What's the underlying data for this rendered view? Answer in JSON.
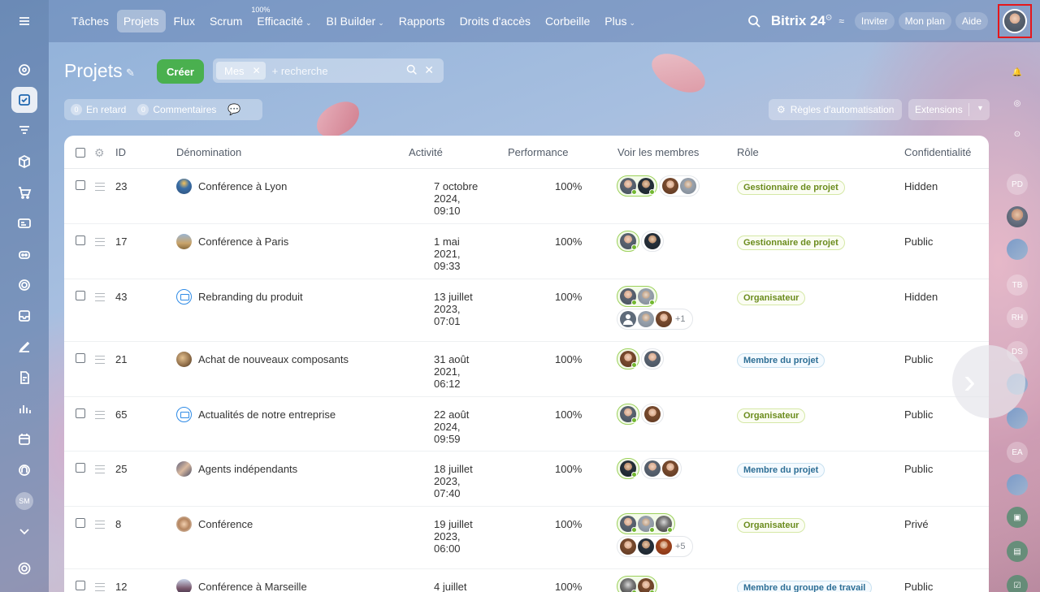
{
  "topbar": {
    "nav": [
      {
        "label": "Tâches",
        "active": false,
        "dropdown": false,
        "sup": ""
      },
      {
        "label": "Projets",
        "active": true,
        "dropdown": false,
        "sup": ""
      },
      {
        "label": "Flux",
        "active": false,
        "dropdown": false,
        "sup": ""
      },
      {
        "label": "Scrum",
        "active": false,
        "dropdown": false,
        "sup": ""
      },
      {
        "label": "Efficacité",
        "active": false,
        "dropdown": true,
        "sup": "100%"
      },
      {
        "label": "BI Builder",
        "active": false,
        "dropdown": true,
        "sup": ""
      },
      {
        "label": "Rapports",
        "active": false,
        "dropdown": false,
        "sup": ""
      },
      {
        "label": "Droits d'accès",
        "active": false,
        "dropdown": false,
        "sup": ""
      },
      {
        "label": "Corbeille",
        "active": false,
        "dropdown": false,
        "sup": ""
      },
      {
        "label": "Plus",
        "active": false,
        "dropdown": true,
        "sup": ""
      }
    ],
    "brand": "Bitrix 24",
    "brand_suffix": "⊙",
    "invite": "Inviter",
    "my_plan": "Mon plan",
    "help": "Aide"
  },
  "header": {
    "title": "Projets",
    "create": "Créer",
    "filter_chip": "Mes",
    "search_placeholder": "+ recherche",
    "late_count": "0",
    "late_label": "En retard",
    "comments_count": "0",
    "comments_label": "Commentaires",
    "automation": "Règles d'automatisation",
    "extensions": "Extensions"
  },
  "table": {
    "columns": {
      "id": "ID",
      "name": "Dénomination",
      "activity": "Activité",
      "performance": "Performance",
      "members": "Voir les membres",
      "role": "Rôle",
      "privacy": "Confidentialité"
    },
    "rows": [
      {
        "id": "23",
        "name": "Conférence à Lyon",
        "icon": "photo1",
        "activity": [
          "7 octobre",
          "2024,",
          "09:10"
        ],
        "performance": "100%",
        "role": "Gestionnaire de projet",
        "role_color": "green",
        "privacy": "Hidden"
      },
      {
        "id": "17",
        "name": "Conférence à Paris",
        "icon": "photo2",
        "activity": [
          "1 mai",
          "2021,",
          "09:33"
        ],
        "performance": "100%",
        "role": "Gestionnaire de projet",
        "role_color": "green",
        "privacy": "Public"
      },
      {
        "id": "43",
        "name": "Rebranding du produit",
        "icon": "folder",
        "activity": [
          "13 juillet",
          "2023,",
          "07:01"
        ],
        "performance": "100%",
        "role": "Organisateur",
        "role_color": "green",
        "privacy": "Hidden",
        "more": "+1"
      },
      {
        "id": "21",
        "name": "Achat de nouveaux composants",
        "icon": "photo3",
        "activity": [
          "31 août",
          "2021,",
          "06:12"
        ],
        "performance": "100%",
        "role": "Membre du projet",
        "role_color": "blue",
        "privacy": "Public"
      },
      {
        "id": "65",
        "name": "Actualités de notre entreprise",
        "icon": "folder",
        "activity": [
          "22 août",
          "2024,",
          "09:59"
        ],
        "performance": "100%",
        "role": "Organisateur",
        "role_color": "green",
        "privacy": "Public"
      },
      {
        "id": "25",
        "name": "Agents indépendants",
        "icon": "photo4",
        "activity": [
          "18 juillet",
          "2023,",
          "07:40"
        ],
        "performance": "100%",
        "role": "Membre du projet",
        "role_color": "blue",
        "privacy": "Public"
      },
      {
        "id": "8",
        "name": "Conférence",
        "icon": "photo5",
        "activity": [
          "19 juillet",
          "2023,",
          "06:00"
        ],
        "performance": "100%",
        "role": "Organisateur",
        "role_color": "green",
        "privacy": "Privé",
        "more": "+5"
      },
      {
        "id": "12",
        "name": "Conférence à Marseille",
        "icon": "photo6",
        "activity": [
          "4 juillet",
          "",
          ""
        ],
        "performance": "100%",
        "role": "Membre du groupe de travail",
        "role_color": "blue",
        "privacy": "Public"
      }
    ]
  },
  "right_bar": {
    "initials": [
      "PD",
      "TB",
      "RH",
      "DS",
      "EA"
    ]
  },
  "left_bar": {
    "user_initials": "SM"
  }
}
